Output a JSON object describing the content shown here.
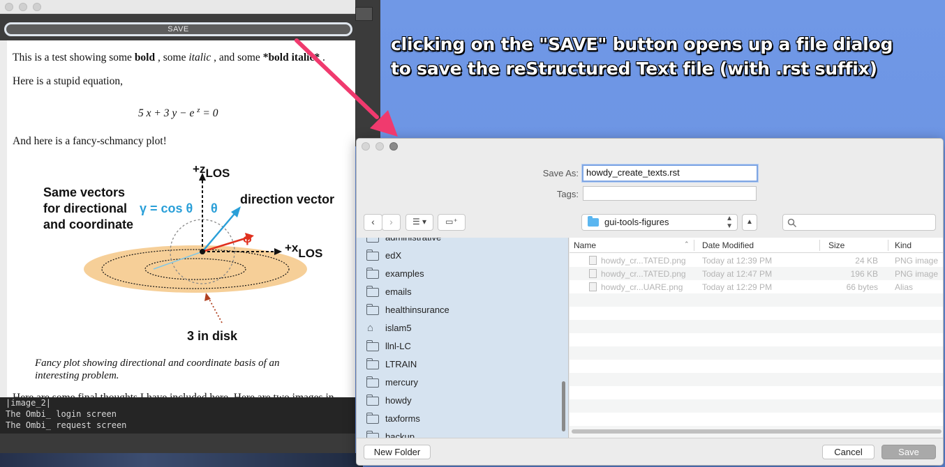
{
  "annotation": {
    "line1": "clicking on the \"SAVE\" button opens up a file dialog",
    "line2": "to save the reStructured Text file (with .rst suffix)"
  },
  "app": {
    "save_label": "SAVE",
    "doc": {
      "p1_a": "This is a test showing some ",
      "p1_bold": "bold",
      "p1_b": " , some ",
      "p1_italic": "italic",
      "p1_c": " , and some ",
      "p1_bolditalic": "*bold italic*",
      "p1_d": " .",
      "p2": "Here is a stupid equation,",
      "p3": "And here is a fancy-schmancy plot!",
      "caption": "Fancy plot showing directional and coordinate basis of an interesting problem.",
      "cut_line": "Here are some final thoughts I have included here. Here are two images in"
    },
    "figure": {
      "label_z": "+z",
      "label_z_sub": "LOS",
      "label_x": "+x",
      "label_x_sub": "LOS",
      "same_vectors_1": "Same vectors",
      "same_vectors_2": "for directional",
      "same_vectors_3": "and coordinate",
      "gamma": "γ = cos θ",
      "theta": "θ",
      "direction_vector": "direction vector",
      "phi": "ϕ",
      "disk": "3 in disk"
    },
    "console": [
      "|image_2|",
      "The Ombi_ login screen",
      "The Ombi_ request screen"
    ]
  },
  "dialog": {
    "save_as_label": "Save As:",
    "save_as_value": "howdy_create_texts.rst",
    "tags_label": "Tags:",
    "tags_value": "",
    "location": "gui-tools-figures",
    "sidebar": [
      "administrative",
      "edX",
      "examples",
      "emails",
      "healthinsurance",
      "islam5",
      "llnl-LC",
      "LTRAIN",
      "mercury",
      "howdy",
      "taxforms",
      "backup"
    ],
    "columns": {
      "name": "Name",
      "date": "Date Modified",
      "size": "Size",
      "kind": "Kind"
    },
    "files": [
      {
        "name": "howdy_cr...TATED.png",
        "date": "Today at 12:39 PM",
        "size": "24 KB",
        "kind": "PNG image"
      },
      {
        "name": "howdy_cr...TATED.png",
        "date": "Today at 12:47 PM",
        "size": "196 KB",
        "kind": "PNG image"
      },
      {
        "name": "howdy_cr...UARE.png",
        "date": "Today at 12:29 PM",
        "size": "66 bytes",
        "kind": "Alias"
      }
    ],
    "new_folder": "New Folder",
    "cancel": "Cancel",
    "save": "Save"
  },
  "colors": {
    "accent_arrow": "#f03a6e",
    "figure_blue": "#2a9fd8",
    "figure_red": "#e0301e",
    "disk": "#f6cf98"
  }
}
